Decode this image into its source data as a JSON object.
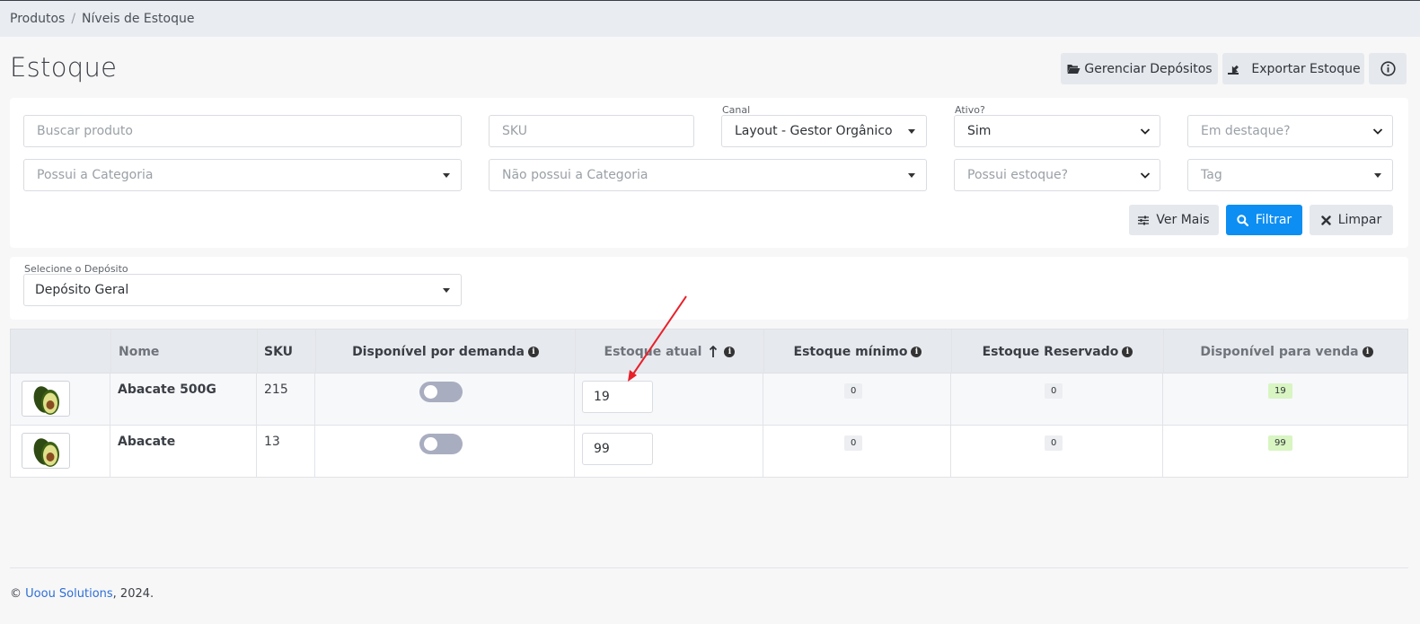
{
  "breadcrumb": {
    "items": [
      "Produtos",
      "Níveis de Estoque"
    ]
  },
  "page": {
    "title": "Estoque"
  },
  "header_actions": {
    "manage_label": "Gerenciar Depósitos",
    "export_label": "Exportar Estoque",
    "info_icon": "info-circle-icon"
  },
  "filters": {
    "search_placeholder": "Buscar produto",
    "sku_placeholder": "SKU",
    "channel_label": "Canal",
    "channel_value": "Layout - Gestor Orgânico",
    "active_label": "Ativo?",
    "active_value": "Sim",
    "featured_placeholder": "Em destaque?",
    "has_category_placeholder": "Possui a Categoria",
    "not_category_placeholder": "Não possui a Categoria",
    "has_stock_placeholder": "Possui estoque?",
    "tag_placeholder": "Tag",
    "see_more_label": "Ver Mais",
    "filter_label": "Filtrar",
    "clear_label": "Limpar"
  },
  "warehouse": {
    "label": "Selecione o Depósito",
    "value": "Depósito Geral"
  },
  "table": {
    "columns": {
      "name": "Nome",
      "sku": "SKU",
      "on_demand": "Disponível por demanda",
      "current_stock": "Estoque atual",
      "min_stock": "Estoque mínimo",
      "reserved": "Estoque Reservado",
      "available": "Disponível para venda"
    },
    "rows": [
      {
        "name": "Abacate 500G",
        "sku": "215",
        "on_demand": false,
        "current_stock": "19",
        "min_stock": "0",
        "reserved": "0",
        "available": "19"
      },
      {
        "name": "Abacate",
        "sku": "13",
        "on_demand": false,
        "current_stock": "99",
        "min_stock": "0",
        "reserved": "0",
        "available": "99"
      }
    ]
  },
  "footer": {
    "copyright": "©",
    "company": "Uoou Solutions",
    "year": ", 2024."
  },
  "colors": {
    "primary": "#0d8ef3",
    "available_badge": "#d8f5c2",
    "annotation_arrow": "#e8202a"
  }
}
